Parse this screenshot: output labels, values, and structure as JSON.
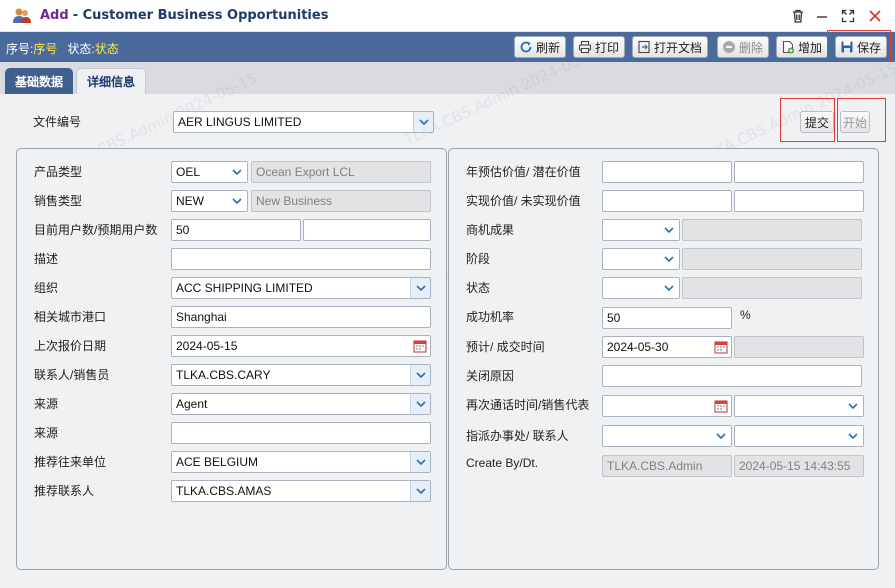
{
  "window": {
    "title_prefix": "Add",
    "title": "- Customer Business Opportunities"
  },
  "status": {
    "seq_label": "序号:",
    "seq_value": "序号",
    "state_label": "状态:",
    "state_value": "状态"
  },
  "toolbar": {
    "refresh": "刷新",
    "print": "打印",
    "open_doc": "打开文档",
    "delete": "删除",
    "add": "增加",
    "save": "保存"
  },
  "tabs": {
    "basic": "基础数据",
    "detail": "详细信息"
  },
  "header": {
    "doc_no_label": "文件编号",
    "doc_no_value": "AER LINGUS LIMITED",
    "submit": "提交",
    "start": "开始"
  },
  "left": {
    "product_type_label": "产品类型",
    "product_type_value": "OEL",
    "product_type_desc": "Ocean Export LCL",
    "sales_type_label": "销售类型",
    "sales_type_value": "NEW",
    "sales_type_desc": "New Business",
    "users_label": "目前用户数/预期用户数",
    "users_current": "50",
    "users_expected": "",
    "desc_label": "描述",
    "desc_value": "",
    "org_label": "组织",
    "org_value": "ACC SHIPPING LIMITED",
    "port_label": "相关城市港口",
    "port_value": "Shanghai",
    "quote_date_label": "上次报价日期",
    "quote_date_value": "2024-05-15",
    "contact_label": "联系人/销售员",
    "contact_value": "TLKA.CBS.CARY",
    "source_label": "来源",
    "source_value": "Agent",
    "source2_label": "来源",
    "source2_value": "",
    "ref_unit_label": "推荐往来单位",
    "ref_unit_value": "ACE BELGIUM",
    "ref_contact_label": "推荐联系人",
    "ref_contact_value": "TLKA.CBS.AMAS"
  },
  "right": {
    "annual_label": "年预估价值/ 潜在价值",
    "realized_label": "实现价值/ 未实现价值",
    "result_label": "商机成果",
    "stage_label": "阶段",
    "state_label": "状态",
    "prob_label": "成功机率",
    "prob_value": "50",
    "prob_unit": "%",
    "deal_time_label": "预计/ 成交时间",
    "deal_time_value": "2024-05-30",
    "close_reason_label": "关闭原因",
    "recall_label": "再次通话时间/销售代表",
    "assign_label": "指派办事处/ 联系人",
    "create_label": "Create By/Dt.",
    "create_by": "TLKA.CBS.Admin",
    "create_dt": "2024-05-15 14:43:55"
  },
  "watermark": "TLKA.CBS.Admin 2024-05-15",
  "colors": {
    "toolbar_bg": "#4a6a9c",
    "tab_active": "#3f5f8f",
    "status_value": "#ffe94a",
    "highlight": "#e23b3b"
  }
}
